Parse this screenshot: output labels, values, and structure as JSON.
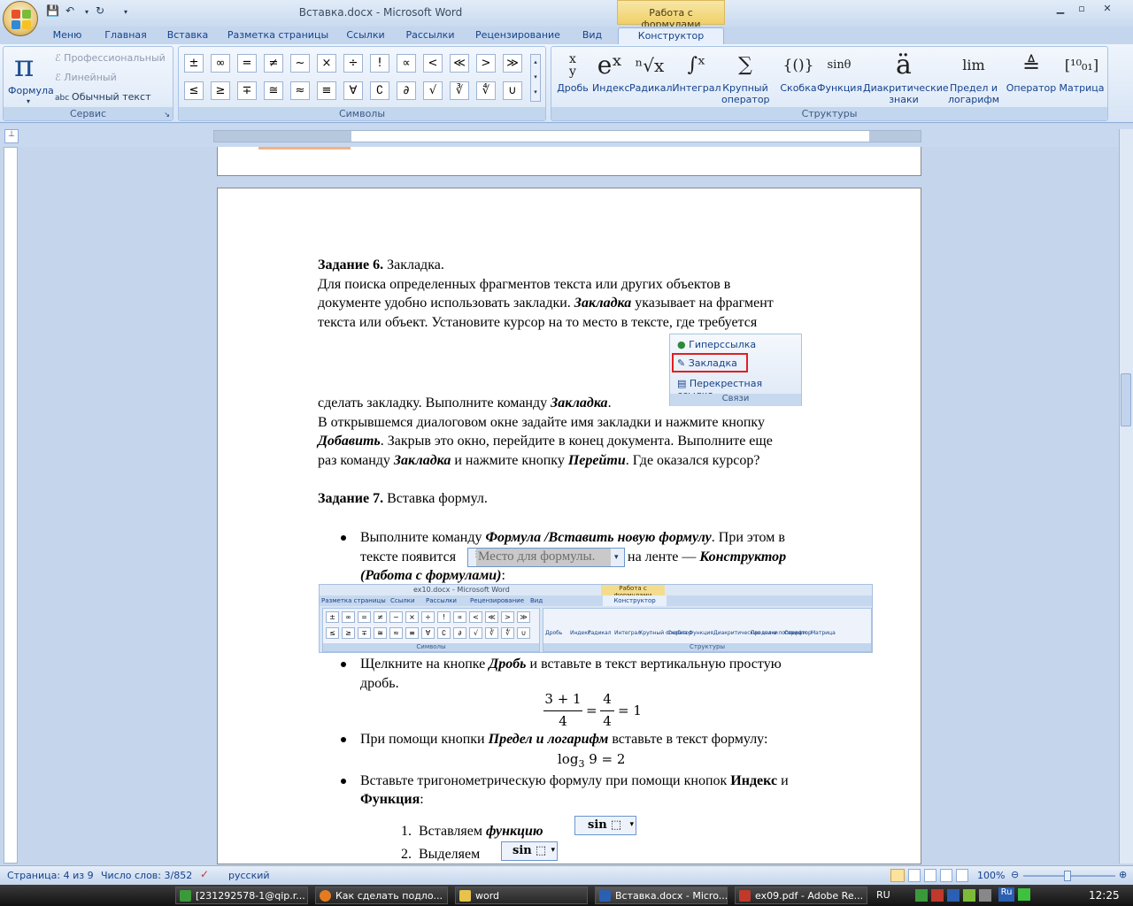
{
  "window": {
    "title": "Вставка.docx - Microsoft Word",
    "context_title": "Работа с формулами"
  },
  "tabs": [
    "Меню",
    "Главная",
    "Вставка",
    "Разметка страницы",
    "Ссылки",
    "Рассылки",
    "Рецензирование",
    "Вид",
    "Конструктор"
  ],
  "ribbon": {
    "service": {
      "formula_label": "Формула",
      "professional": "Профессиональный",
      "linear": "Линейный",
      "normal_text": "Обычный текст",
      "group_label": "Сервис"
    },
    "symbols": {
      "row1": [
        "±",
        "∞",
        "=",
        "≠",
        "~",
        "×",
        "÷",
        "!",
        "∝",
        "<",
        "≪",
        ">",
        "≫"
      ],
      "row2": [
        "≤",
        "≥",
        "∓",
        "≅",
        "≈",
        "≡",
        "∀",
        "∁",
        "∂",
        "√",
        "∛",
        "∜",
        "∪"
      ],
      "group_label": "Символы"
    },
    "structures": {
      "items": [
        "Дробь",
        "Индекс",
        "Радикал",
        "Интеграл",
        "Крупный оператор",
        "Скобка",
        "Функция",
        "Диакритические знаки",
        "Предел и логарифм",
        "Оператор",
        "Матрица"
      ],
      "group_label": "Структуры"
    }
  },
  "document": {
    "t6_head": "Задание 6.",
    "t6_head_rest": " Закладка.",
    "p1": "Для поиска определенных фрагментов текста или других объектов в",
    "p2a": "документе удобно использовать закладки. ",
    "p2b": "Закладка",
    "p2c": " указывает на фрагмент",
    "p3": "текста или объект. Установите курсор на то место в тексте,  где требуется",
    "p4a": "сделать закладку. Выполните команду ",
    "p4b": "Закладка",
    "p5": " В открывшемся диалоговом окне задайте имя закладки и нажмите кнопку",
    "p6a": "Добавить",
    "p6b": ". Закрыв это окно, перейдите в конец документа. Выполните еще",
    "p7a": "раз команду ",
    "p7b": "Закладка",
    "p7c": " и нажмите кнопку ",
    "p7d": "Перейти",
    "p7e": ". Где оказался курсор?",
    "t7_head": "Задание 7.",
    "t7_head_rest": " Вставка формул.",
    "b1a": "Выполните команду ",
    "b1b": "Формула /Вставить новую формулу",
    "b1c": ". При этом в",
    "b1d": "тексте появится",
    "b1e": " на ленте — ",
    "b1f": "Конструктор",
    "b1g": "(Работа с формулами)",
    "b1h": ":",
    "placeholder": "Место для формулы.",
    "b2a": "Щелкните на кнопке ",
    "b2b": "Дробь",
    "b2c": " и вставьте в текст вертикальную простую",
    "b2d": "дробь.",
    "frac_num1": "3 + 1",
    "frac_den1": "4",
    "frac_eq1": "=",
    "frac_num2": "4",
    "frac_den2": "4",
    "frac_eq2": "= 1",
    "b3a": "При помощи кнопки ",
    "b3b": "Предел и логарифм",
    "b3c": " вставьте в текст  формулу:",
    "log_formula": "log",
    "log_base": "3",
    "log_rest": " 9 = 2",
    "b4a": "Вставьте тригонометрическую формулу при помощи кнопок ",
    "b4b": "Индекс",
    "b4c": " и",
    "b4d": "Функция",
    "b4e": ":",
    "n1_num": "1.",
    "n1a": "Вставляем ",
    "n1b": "функцию",
    "n2_num": "2.",
    "n2a": "Выделяем",
    "sin": "sin"
  },
  "links_panel": {
    "hyperlink": "Гиперссылка",
    "bookmark": "Закладка",
    "crossref": "Перекрестная ссылка",
    "group": "Связи"
  },
  "mini_ribbon": {
    "title": "ex10.docx - Microsoft Word",
    "ctx": "Работа с формулами",
    "tabs": [
      "Разметка страницы",
      "Ссылки",
      "Рассылки",
      "Рецензирование",
      "Вид",
      "Конструктор"
    ],
    "symbols_label": "Символы",
    "structures_label": "Структуры"
  },
  "status": {
    "page": "Страница: 4 из 9",
    "words": "Число слов: 3/852",
    "lang": "русский",
    "zoom": "100%"
  },
  "taskbar": {
    "items": [
      "[231292578-1@qip.r...",
      "Как сделать подло...",
      "word",
      "Вставка.docx - Micro...",
      "ex09.pdf - Adobe Re..."
    ],
    "lang": "RU",
    "time": "12:25"
  }
}
